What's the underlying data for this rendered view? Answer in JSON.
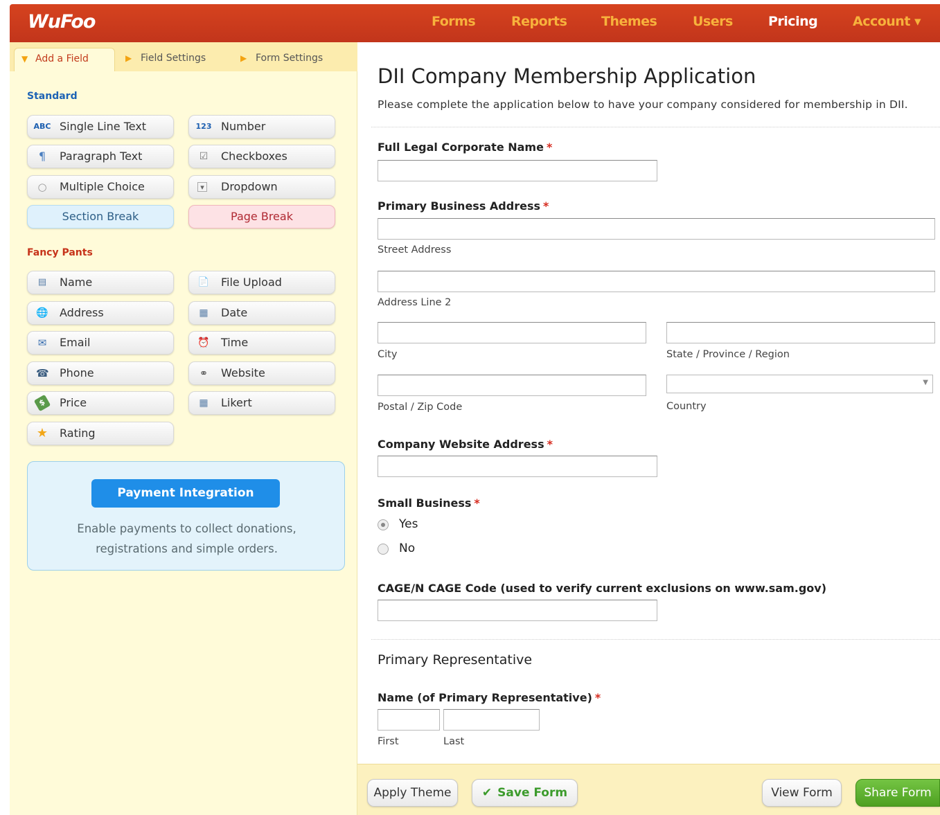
{
  "header": {
    "logo": "WuFoo",
    "nav": [
      "Forms",
      "Reports",
      "Themes",
      "Users",
      "Pricing",
      "Account ▾"
    ]
  },
  "sidebar": {
    "tabs": [
      "Add a Field",
      "Field Settings",
      "Form Settings"
    ],
    "standard_heading": "Standard",
    "standard": [
      {
        "label": "Single Line Text",
        "icon": "ABC"
      },
      {
        "label": "Number",
        "icon": "123"
      },
      {
        "label": "Paragraph Text",
        "icon": "¶"
      },
      {
        "label": "Checkboxes",
        "icon": "☑"
      },
      {
        "label": "Multiple Choice",
        "icon": "○"
      },
      {
        "label": "Dropdown",
        "icon": "▾"
      },
      {
        "label": "Section Break",
        "icon": ""
      },
      {
        "label": "Page Break",
        "icon": ""
      }
    ],
    "fancy_heading": "Fancy Pants",
    "fancy": [
      {
        "label": "Name",
        "icon": "▤"
      },
      {
        "label": "File Upload",
        "icon": "📄"
      },
      {
        "label": "Address",
        "icon": "🌐"
      },
      {
        "label": "Date",
        "icon": "▦"
      },
      {
        "label": "Email",
        "icon": "✉"
      },
      {
        "label": "Time",
        "icon": "⏰"
      },
      {
        "label": "Phone",
        "icon": "☎"
      },
      {
        "label": "Website",
        "icon": "⚭"
      },
      {
        "label": "Price",
        "icon": "$"
      },
      {
        "label": "Likert",
        "icon": "▦"
      },
      {
        "label": "Rating",
        "icon": "★"
      }
    ],
    "payment": {
      "button": "Payment Integration",
      "text": "Enable payments to collect donations, registrations and simple orders."
    }
  },
  "form": {
    "title": "DII Company Membership Application",
    "description": "Please complete the application below to have your company considered for membership in DII.",
    "full_name_label": "Full Legal Corporate Name",
    "address_label": "Primary Business Address",
    "street": "Street Address",
    "line2": "Address Line 2",
    "city": "City",
    "state": "State / Province / Region",
    "zip": "Postal / Zip Code",
    "country": "Country",
    "website_label": "Company Website Address",
    "small_business_label": "Small Business",
    "yes": "Yes",
    "no": "No",
    "cage_label": "CAGE/N CAGE Code (used to verify current exclusions on www.sam.gov)",
    "section": "Primary Representative",
    "rep_name_label": "Name (of Primary Representative)",
    "first": "First",
    "last": "Last",
    "required_mark": "*"
  },
  "footer": {
    "apply_theme": "Apply Theme",
    "save_form": "Save Form",
    "view_form": "View Form",
    "share_form": "Share Form"
  },
  "colors": {
    "brand": "#c9371d",
    "accent": "#f7b23c",
    "sidebar": "#fffbd9"
  }
}
